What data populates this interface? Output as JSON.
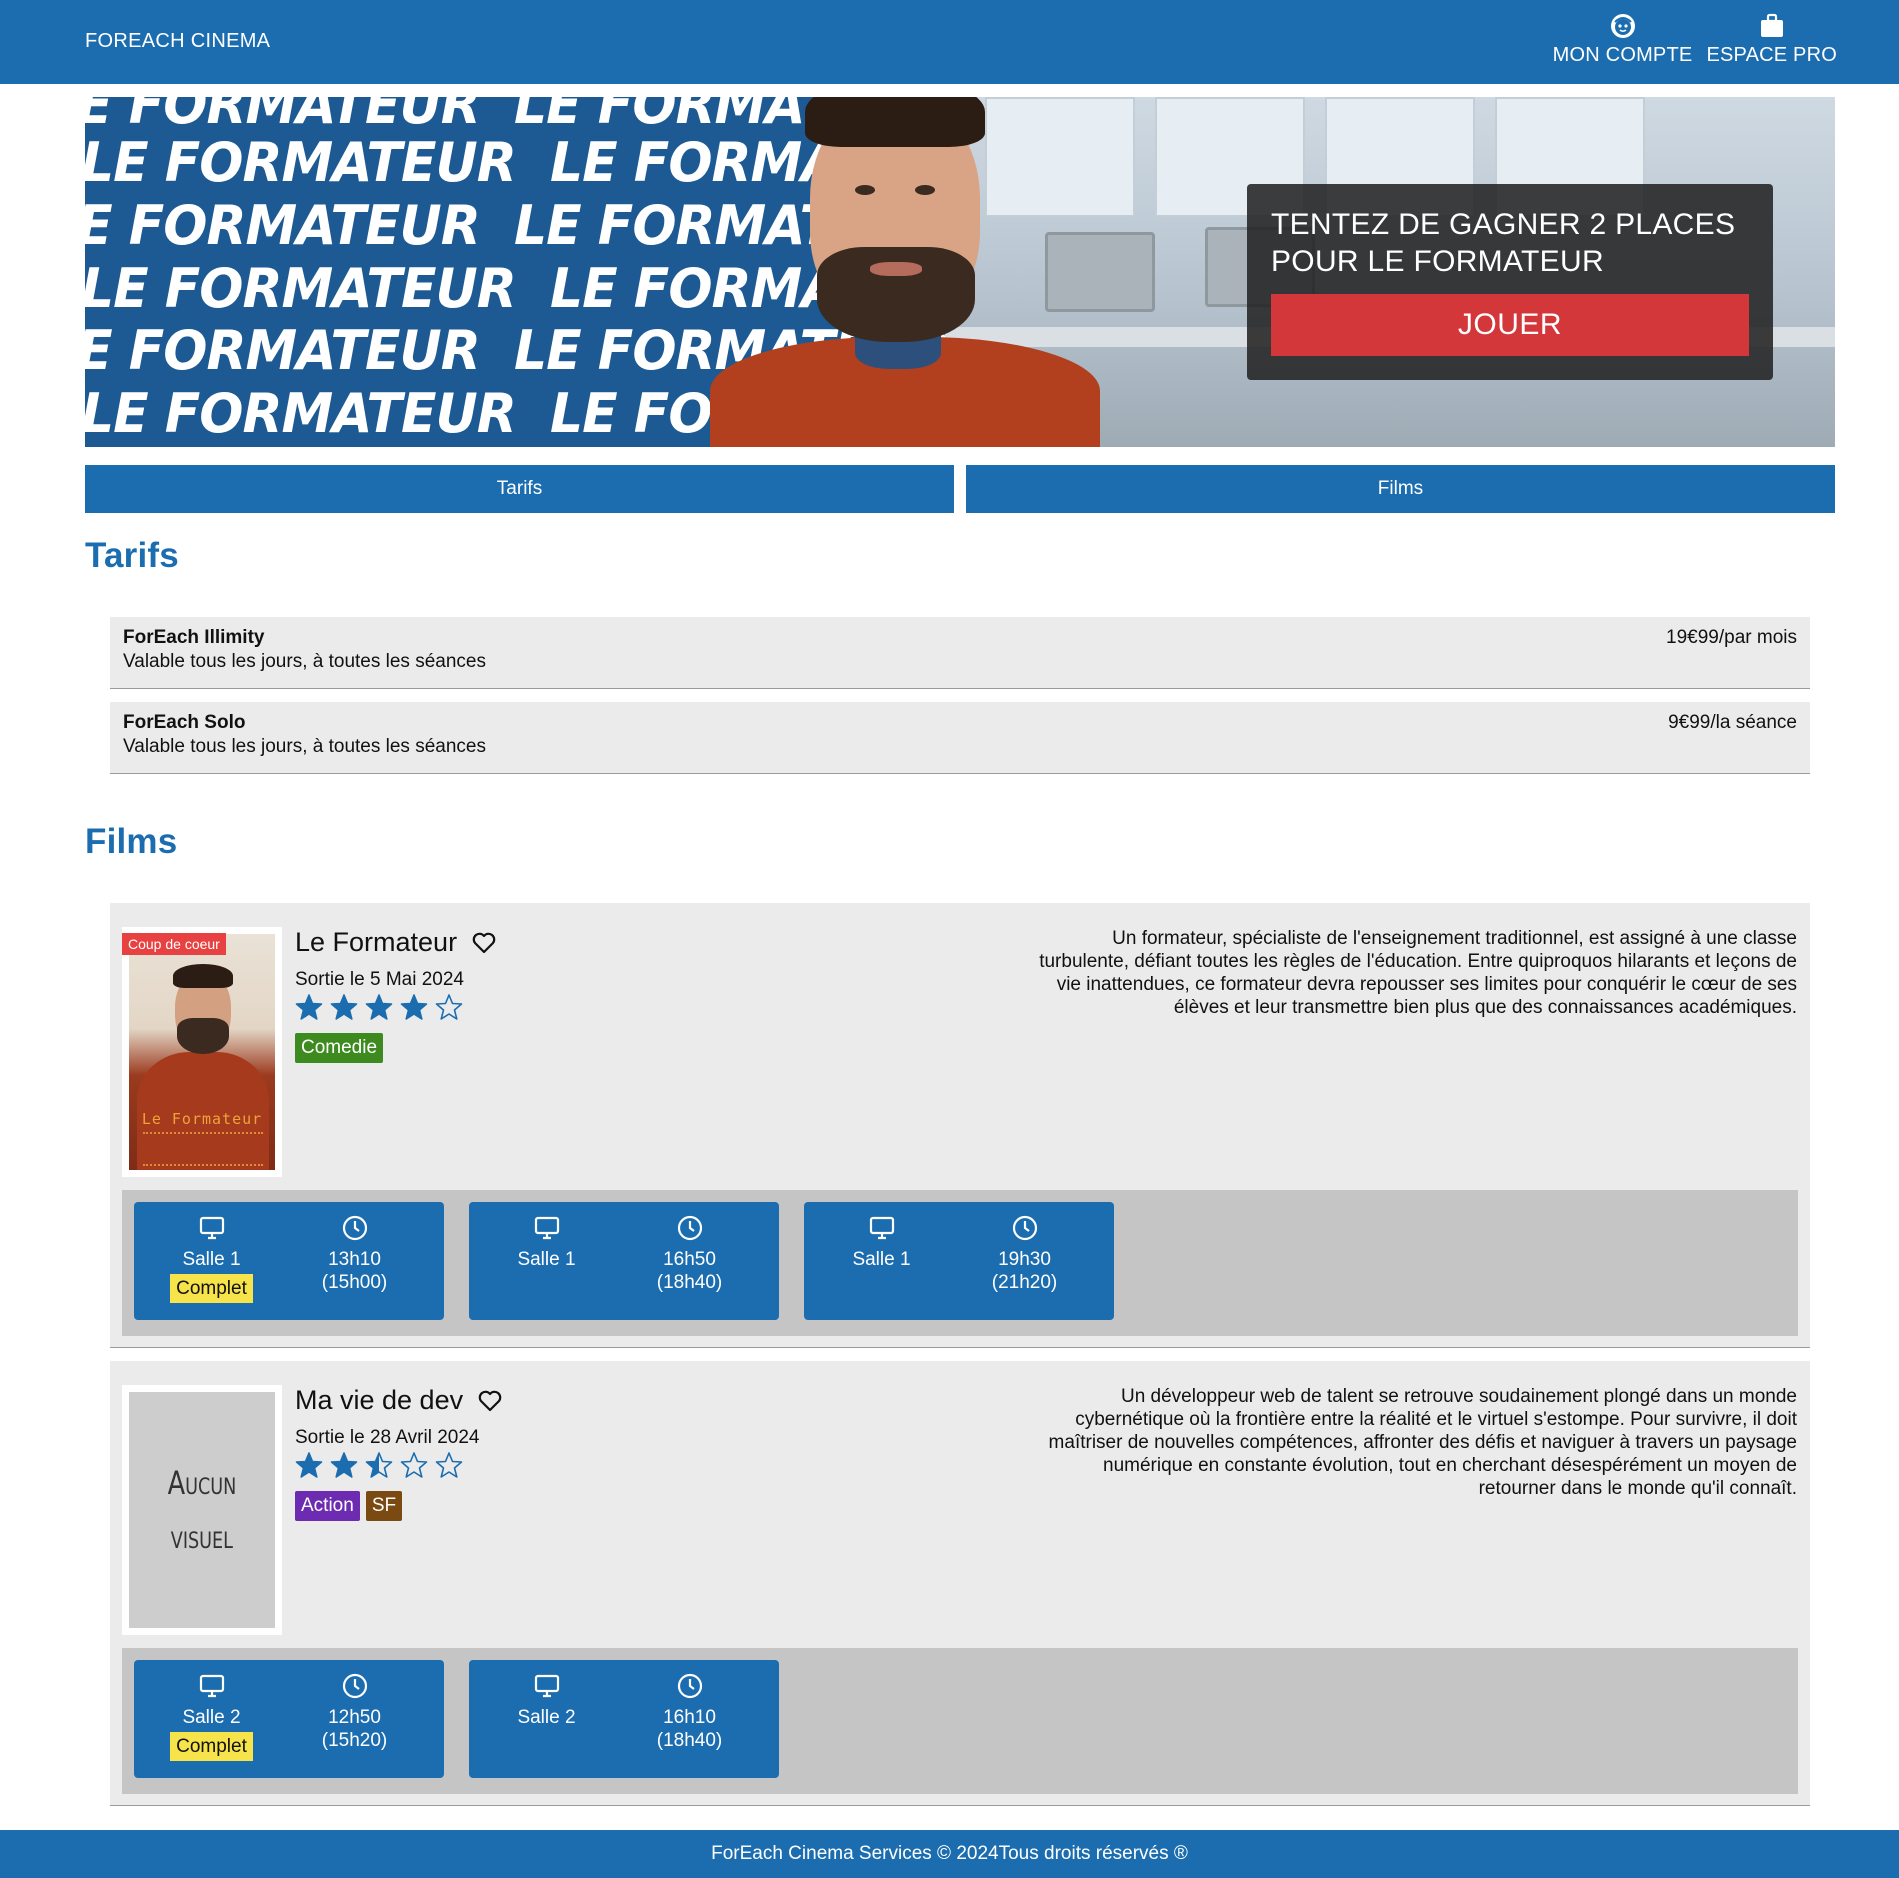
{
  "header": {
    "brand": "FOREACH CINEMA",
    "nav": [
      {
        "label": "MON COMPTE",
        "icon": "account-icon"
      },
      {
        "label": "ESPACE PRO",
        "icon": "briefcase-icon"
      }
    ]
  },
  "banner": {
    "repeated_text": "LE FORMATEUR",
    "promo_title": "TENTEZ DE GAGNER 2 PLACES POUR LE FORMATEUR",
    "promo_button": "JOUER"
  },
  "tabs": [
    "Tarifs",
    "Films"
  ],
  "tarifs": {
    "title": "Tarifs",
    "items": [
      {
        "name": "ForEach Illimity",
        "description": "Valable tous les jours, à toutes les séances",
        "price": "19€99/par mois"
      },
      {
        "name": "ForEach Solo",
        "description": "Valable tous les jours, à toutes les séances",
        "price": "9€99/la séance"
      }
    ]
  },
  "films": {
    "title": "Films",
    "items": [
      {
        "title": "Le Formateur",
        "badge": "Coup de coeur",
        "poster_title": "Le Formateur",
        "release": "Sortie le 5 Mai 2024",
        "rating": 4,
        "max_rating": 5,
        "genres": [
          {
            "label": "Comedie",
            "color": "#3d8b1e"
          }
        ],
        "synopsis": "Un formateur, spécialiste de l'enseignement traditionnel, est assigné à une classe turbulente, défiant toutes les règles de l'éducation. Entre quiproquos hilarants et leçons de vie inattendues, ce formateur devra repousser ses limites pour conquérir le cœur de ses élèves et leur transmettre bien plus que des connaissances académiques.",
        "sessions": [
          {
            "room": "Salle 1",
            "status": "Complet",
            "start": "13h10",
            "end": "(15h00)"
          },
          {
            "room": "Salle 1",
            "status": "",
            "start": "16h50",
            "end": "(18h40)"
          },
          {
            "room": "Salle 1",
            "status": "",
            "start": "19h30",
            "end": "(21h20)"
          }
        ]
      },
      {
        "title": "Ma vie de dev",
        "poster_placeholder": [
          "Aucun",
          "visuel"
        ],
        "release": "Sortie le 28 Avril 2024",
        "rating": 2.5,
        "max_rating": 5,
        "genres": [
          {
            "label": "Action",
            "color": "#6c2bb0"
          },
          {
            "label": "SF",
            "color": "#7a4a12"
          }
        ],
        "synopsis": "Un développeur web de talent se retrouve soudainement plongé dans un monde cybernétique où la frontière entre la réalité et le virtuel s'estompe. Pour survivre, il doit maîtriser de nouvelles compétences, affronter des défis et naviguer à travers un paysage numérique en constante évolution, tout en cherchant désespérément un moyen de retourner dans le monde qu'il connaît.",
        "sessions": [
          {
            "room": "Salle 2",
            "status": "Complet",
            "start": "12h50",
            "end": "(15h20)"
          },
          {
            "room": "Salle 2",
            "status": "",
            "start": "16h10",
            "end": "(18h40)"
          }
        ]
      }
    ]
  },
  "footer": {
    "text": "ForEach Cinema Services © 2024Tous droits réservés ®"
  },
  "colors": {
    "primary": "#1b6db0",
    "accent": "#d4373a",
    "complet": "#f7e34a",
    "badge": "#e84141"
  }
}
